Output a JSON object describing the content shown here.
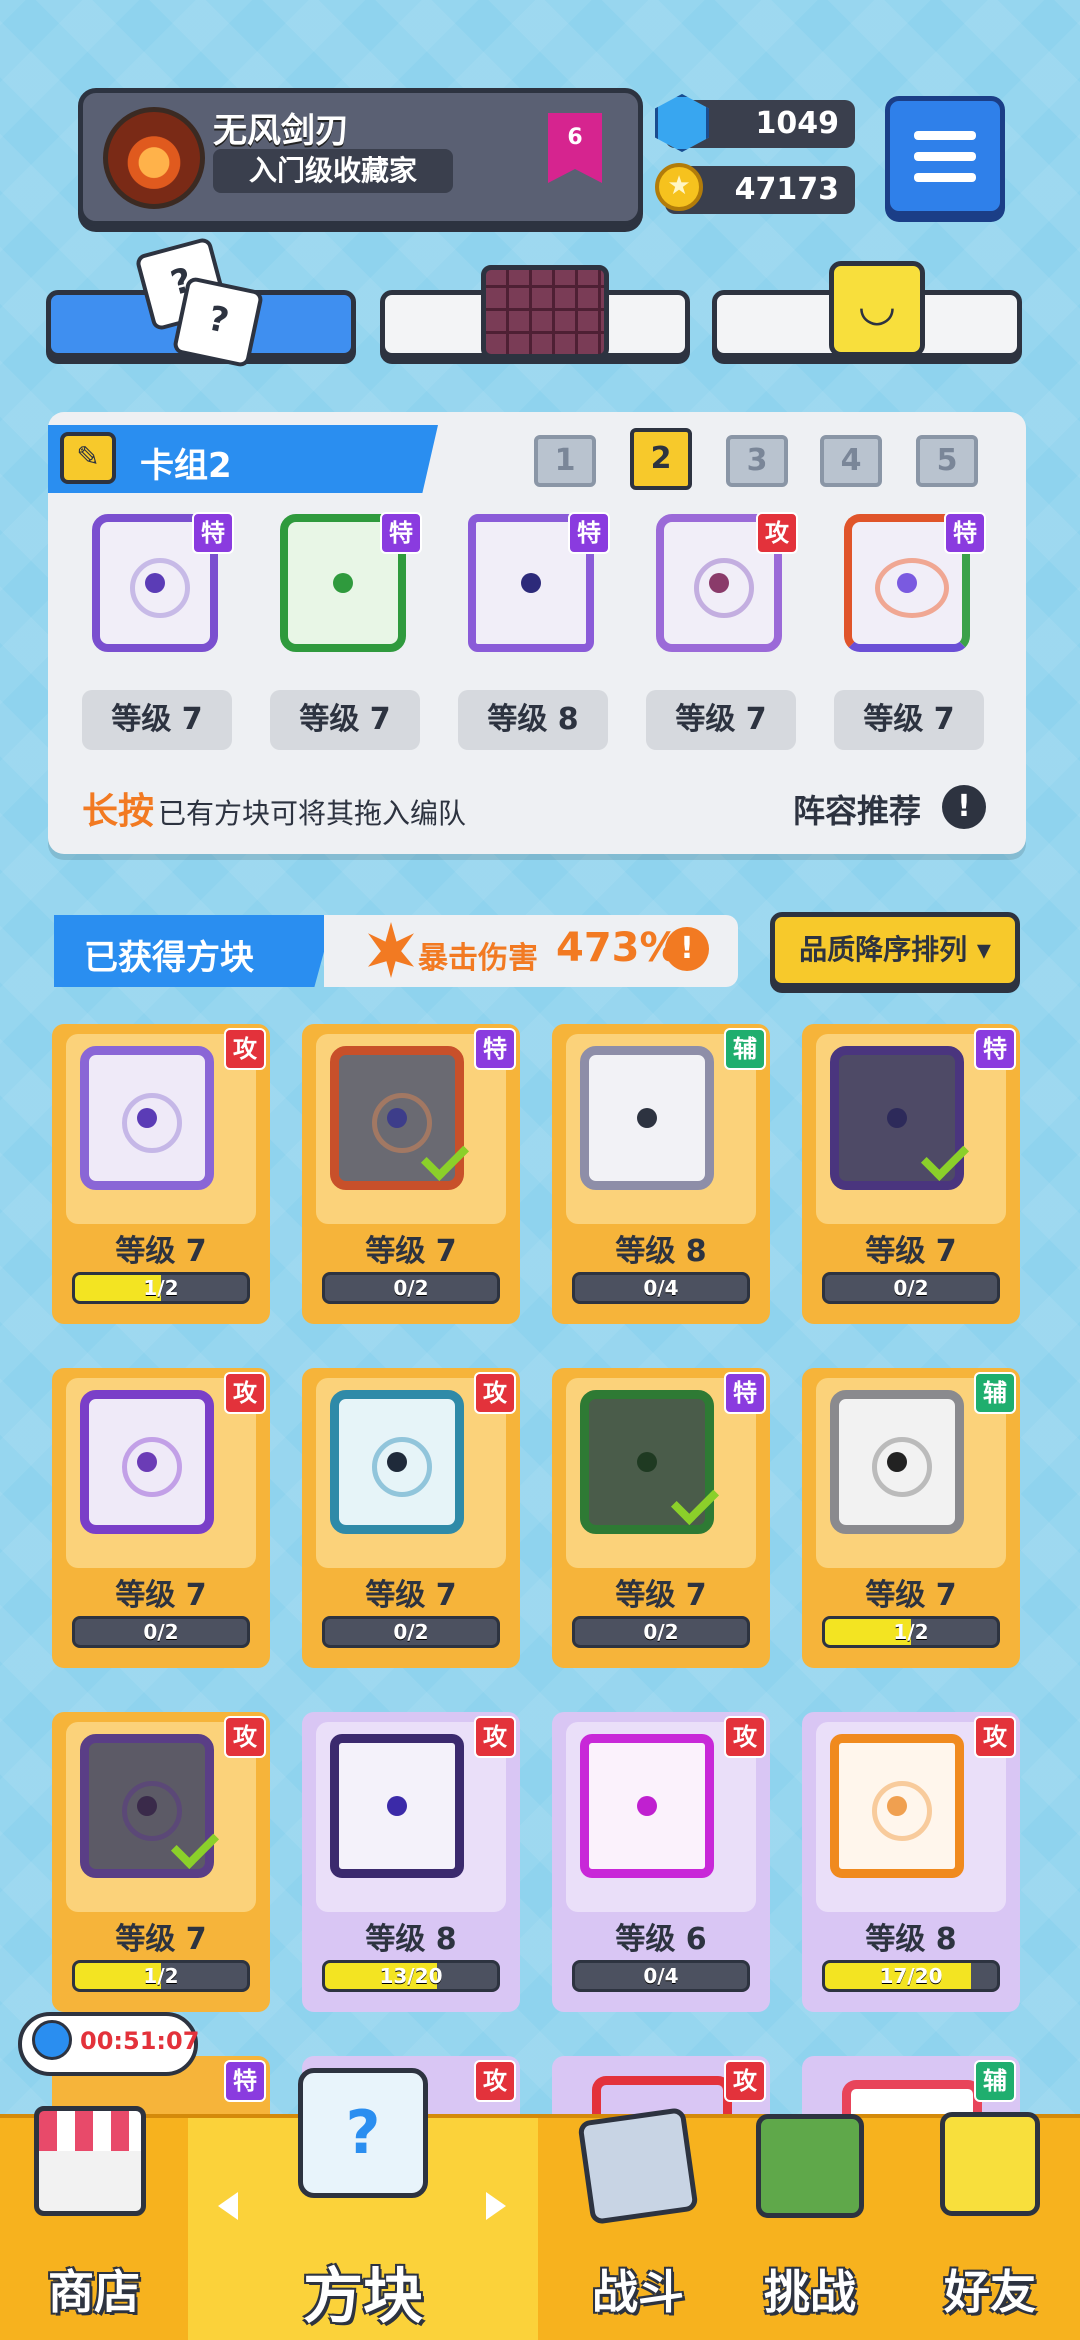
{
  "profile": {
    "name": "无风剑刃",
    "title": "入门级收藏家",
    "rank": "6"
  },
  "resources": {
    "gems": "1049",
    "coins": "47173"
  },
  "deck": {
    "name": "卡组2",
    "slots": [
      "1",
      "2",
      "3",
      "4",
      "5"
    ],
    "active_slot": "2",
    "cards": [
      {
        "type": "特",
        "level": "等级 7"
      },
      {
        "type": "特",
        "level": "等级 7"
      },
      {
        "type": "特",
        "level": "等级 8"
      },
      {
        "type": "攻",
        "level": "等级 7"
      },
      {
        "type": "特",
        "level": "等级 7"
      }
    ],
    "hint_highlight": "长按",
    "hint_rest": "已有方块可将其拖入编队",
    "recommend": "阵容推荐",
    "warn": "!"
  },
  "owned": {
    "title": "已获得方块",
    "crit_label": "暴击伤害",
    "crit_value": "473%",
    "crit_warn": "!",
    "sort_label": "品质降序排列 ▾",
    "cards": [
      {
        "type": "攻",
        "level": "等级 7",
        "progress": "1/2"
      },
      {
        "type": "特",
        "level": "等级 7",
        "progress": "0/2"
      },
      {
        "type": "辅",
        "level": "等级 8",
        "progress": "0/4"
      },
      {
        "type": "特",
        "level": "等级 7",
        "progress": "0/2"
      },
      {
        "type": "攻",
        "level": "等级 7",
        "progress": "0/2"
      },
      {
        "type": "攻",
        "level": "等级 7",
        "progress": "0/2"
      },
      {
        "type": "特",
        "level": "等级 7",
        "progress": "0/2"
      },
      {
        "type": "辅",
        "level": "等级 7",
        "progress": "1/2"
      },
      {
        "type": "攻",
        "level": "等级 7",
        "progress": "1/2"
      },
      {
        "type": "攻",
        "level": "等级 8",
        "progress": "13/20"
      },
      {
        "type": "攻",
        "level": "等级 6",
        "progress": "0/4"
      },
      {
        "type": "攻",
        "level": "等级 8",
        "progress": "17/20"
      }
    ],
    "partial_tags": [
      "特",
      "攻",
      "攻",
      "辅"
    ]
  },
  "timer": "00:51:07",
  "nav": {
    "shop": "商店",
    "blocks": "方块",
    "battle": "战斗",
    "challenge": "挑战",
    "friends": "好友"
  },
  "colors": {
    "background": "#8fd3ee",
    "accent_blue": "#2a8ef0",
    "accent_yellow": "#f7c92b",
    "orange": "#f27a22",
    "attack": "#e3323b",
    "special": "#8a3bdf",
    "support": "#1fae6e"
  }
}
